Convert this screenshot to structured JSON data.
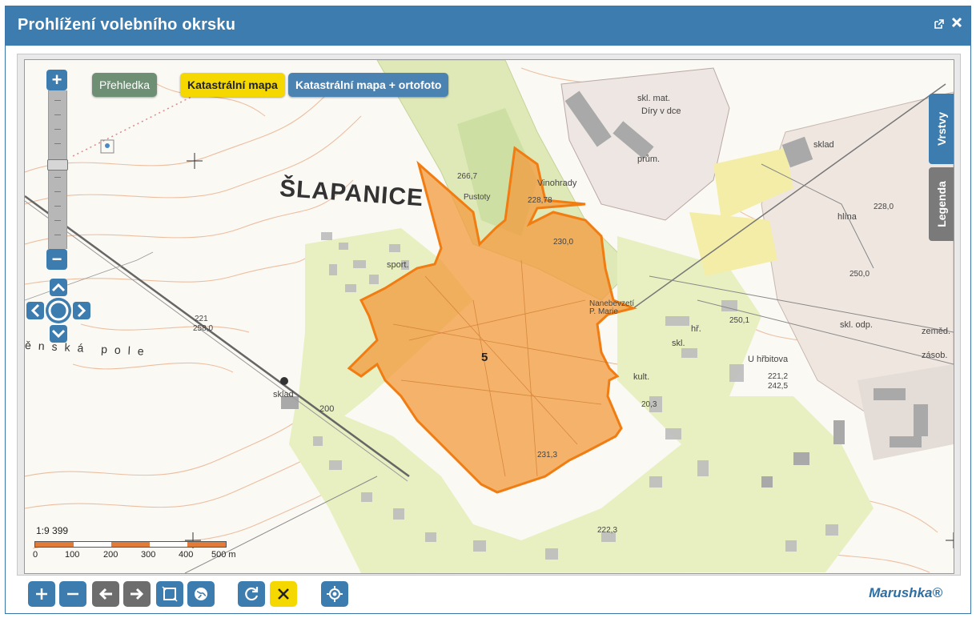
{
  "window": {
    "title": "Prohlížení volebního okrsku",
    "popout_icon": "popout-icon",
    "close_icon": "close-icon"
  },
  "map": {
    "buttons": {
      "overview": "Přehledka",
      "cadastral": "Katastrální mapa",
      "cadastral_ortho": "Katastrální mapa + ortofoto"
    },
    "side_tabs": {
      "layers": "Vrstvy",
      "legend": "Legenda"
    },
    "town_label": "ŠLAPANICE",
    "district_number": "5",
    "labels": [
      "skl. mat.",
      "Díry v dce",
      "sklad",
      "prům.",
      "Vinohrady",
      "Pustoty",
      "266,7",
      "228,78",
      "230,0",
      "228,0",
      "250,0",
      "250,1",
      "sport.",
      "Nanebevzetí P. Marie",
      "hř.",
      "zeměd.",
      "zásob.",
      "skl. odp.",
      "U hřbitova",
      "hlína",
      "skl.",
      "kult.",
      "sklad",
      "200",
      "20,3",
      "221",
      "258,0",
      "221,2",
      "242,5",
      "231,3",
      "222,3",
      "ěnská pole"
    ],
    "scale": {
      "ratio": "1:9 399",
      "ticks": [
        "0",
        "100",
        "200",
        "300",
        "400",
        "500 m"
      ]
    }
  },
  "toolbar": {
    "buttons": [
      "zoom-in",
      "zoom-out",
      "back",
      "forward",
      "zoom-extent",
      "globe",
      "refresh",
      "clear",
      "locate"
    ],
    "brand": "Marushka®"
  },
  "colors": {
    "accent": "#3d7cae",
    "district_fill": "#f39a3c",
    "district_stroke": "#f07c12",
    "active_button": "#f5d800",
    "overview_button": "#6e8f74",
    "urban": "#e8efc0"
  }
}
